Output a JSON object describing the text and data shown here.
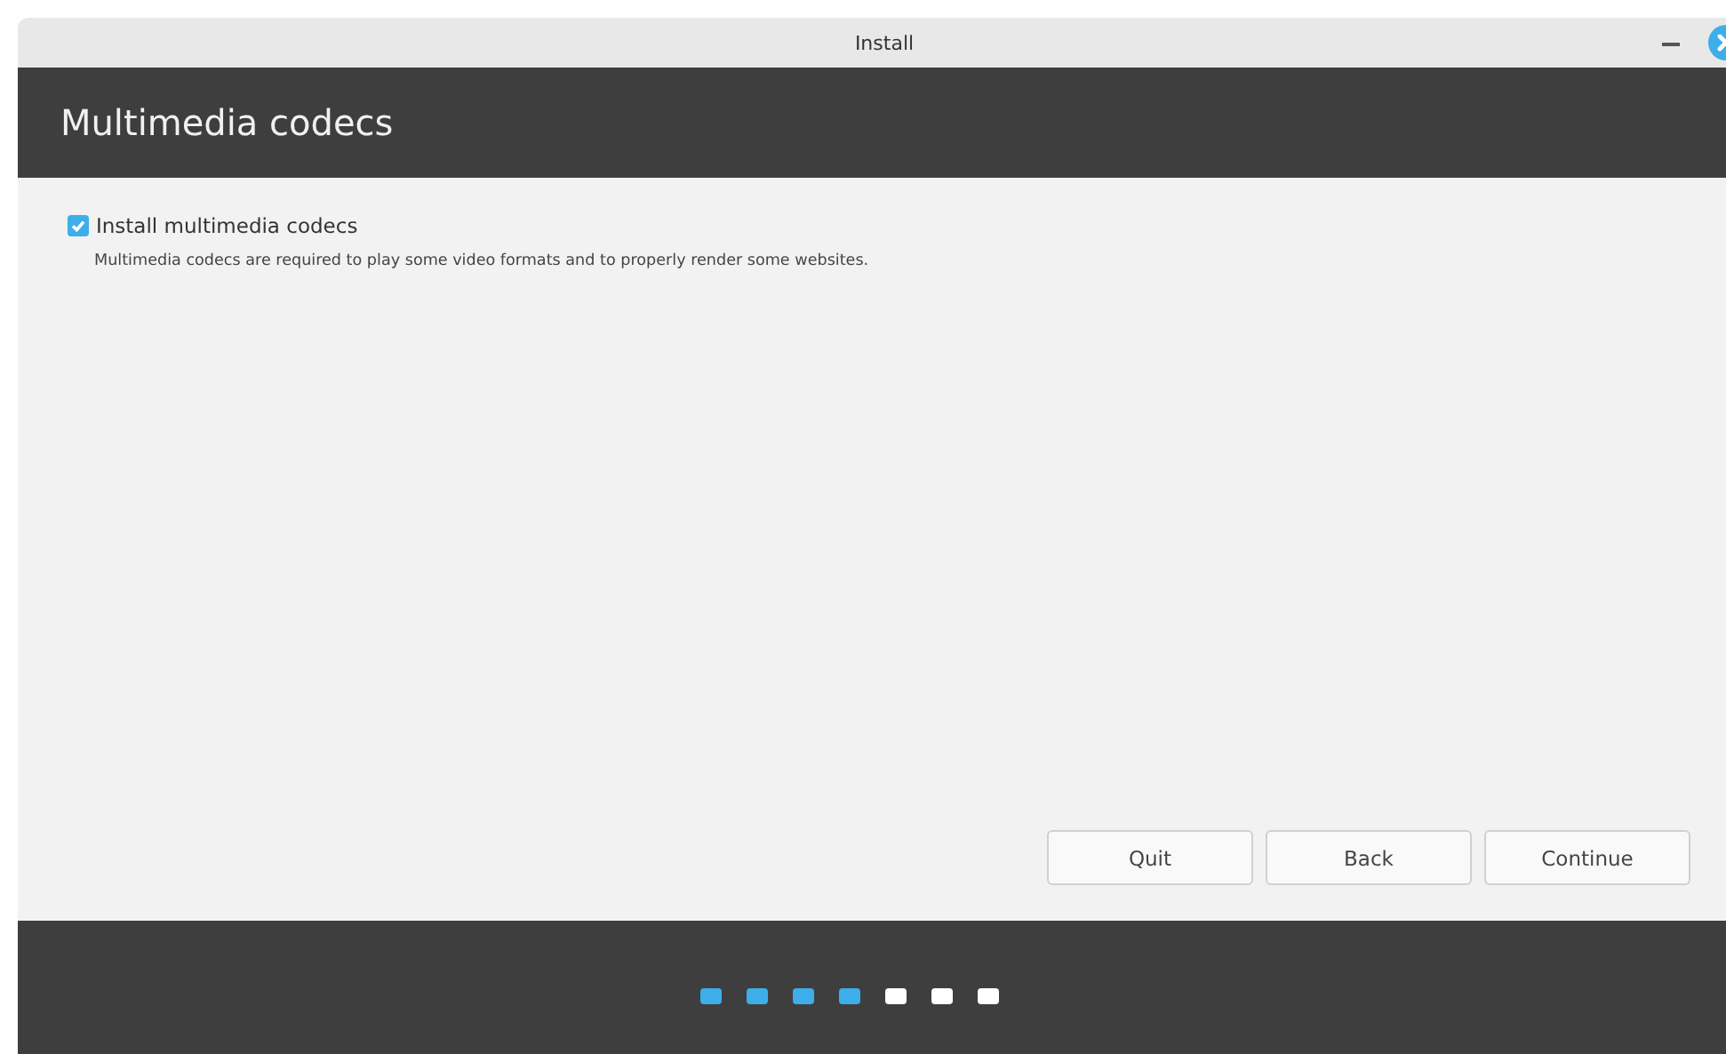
{
  "window": {
    "title": "Install"
  },
  "header": {
    "title": "Multimedia codecs"
  },
  "option": {
    "label": "Install multimedia codecs",
    "checked": true,
    "description": "Multimedia codecs are required to play some video formats and to properly render some websites."
  },
  "buttons": [
    "Quit",
    "Back",
    "Continue"
  ],
  "steps": [
    {
      "done": true
    },
    {
      "done": true
    },
    {
      "done": true
    },
    {
      "done": true
    },
    {
      "done": false
    },
    {
      "done": false
    },
    {
      "done": false
    }
  ]
}
